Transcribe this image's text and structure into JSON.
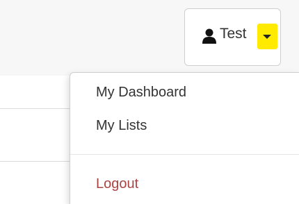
{
  "header": {
    "user_menu": {
      "username": "Test",
      "user_icon": "user-icon",
      "caret_icon": "caret-down-icon",
      "highlight_color": "#ffea00"
    }
  },
  "dropdown": {
    "items": [
      {
        "label": "My Dashboard"
      },
      {
        "label": "My Lists"
      }
    ],
    "logout": {
      "label": "Logout",
      "color": "#a94442"
    }
  }
}
